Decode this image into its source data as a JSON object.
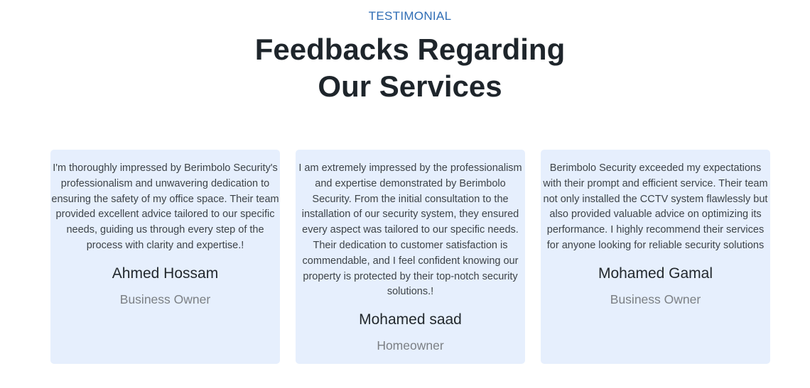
{
  "section": {
    "eyebrow": "TESTIMONIAL",
    "heading_line1": "Feedbacks Regarding",
    "heading_line2": "Our Services"
  },
  "testimonials": [
    {
      "quote": "I'm thoroughly impressed by Berimbolo Security's professionalism and unwavering dedication to ensuring the safety of my office space. Their team provided excellent advice tailored to our specific needs, guiding us through every step of the process with clarity and expertise.!",
      "name": "Ahmed Hossam",
      "role": "Business Owner"
    },
    {
      "quote": "I am extremely impressed by the professionalism and expertise demonstrated by Berimbolo Security. From the initial consultation to the installation of our security system, they ensured every aspect was tailored to our specific needs. Their dedication to customer satisfaction is commendable, and I feel confident knowing our property is protected by their top-notch security solutions.!",
      "name": "Mohamed saad",
      "role": "Homeowner"
    },
    {
      "quote": "Berimbolo Security exceeded my expectations with their prompt and efficient service. Their team not only installed the CCTV system flawlessly but also provided valuable advice on optimizing its performance. I highly recommend their services for anyone looking for reliable security solutions",
      "name": "Mohamed Gamal",
      "role": "Business Owner"
    }
  ]
}
